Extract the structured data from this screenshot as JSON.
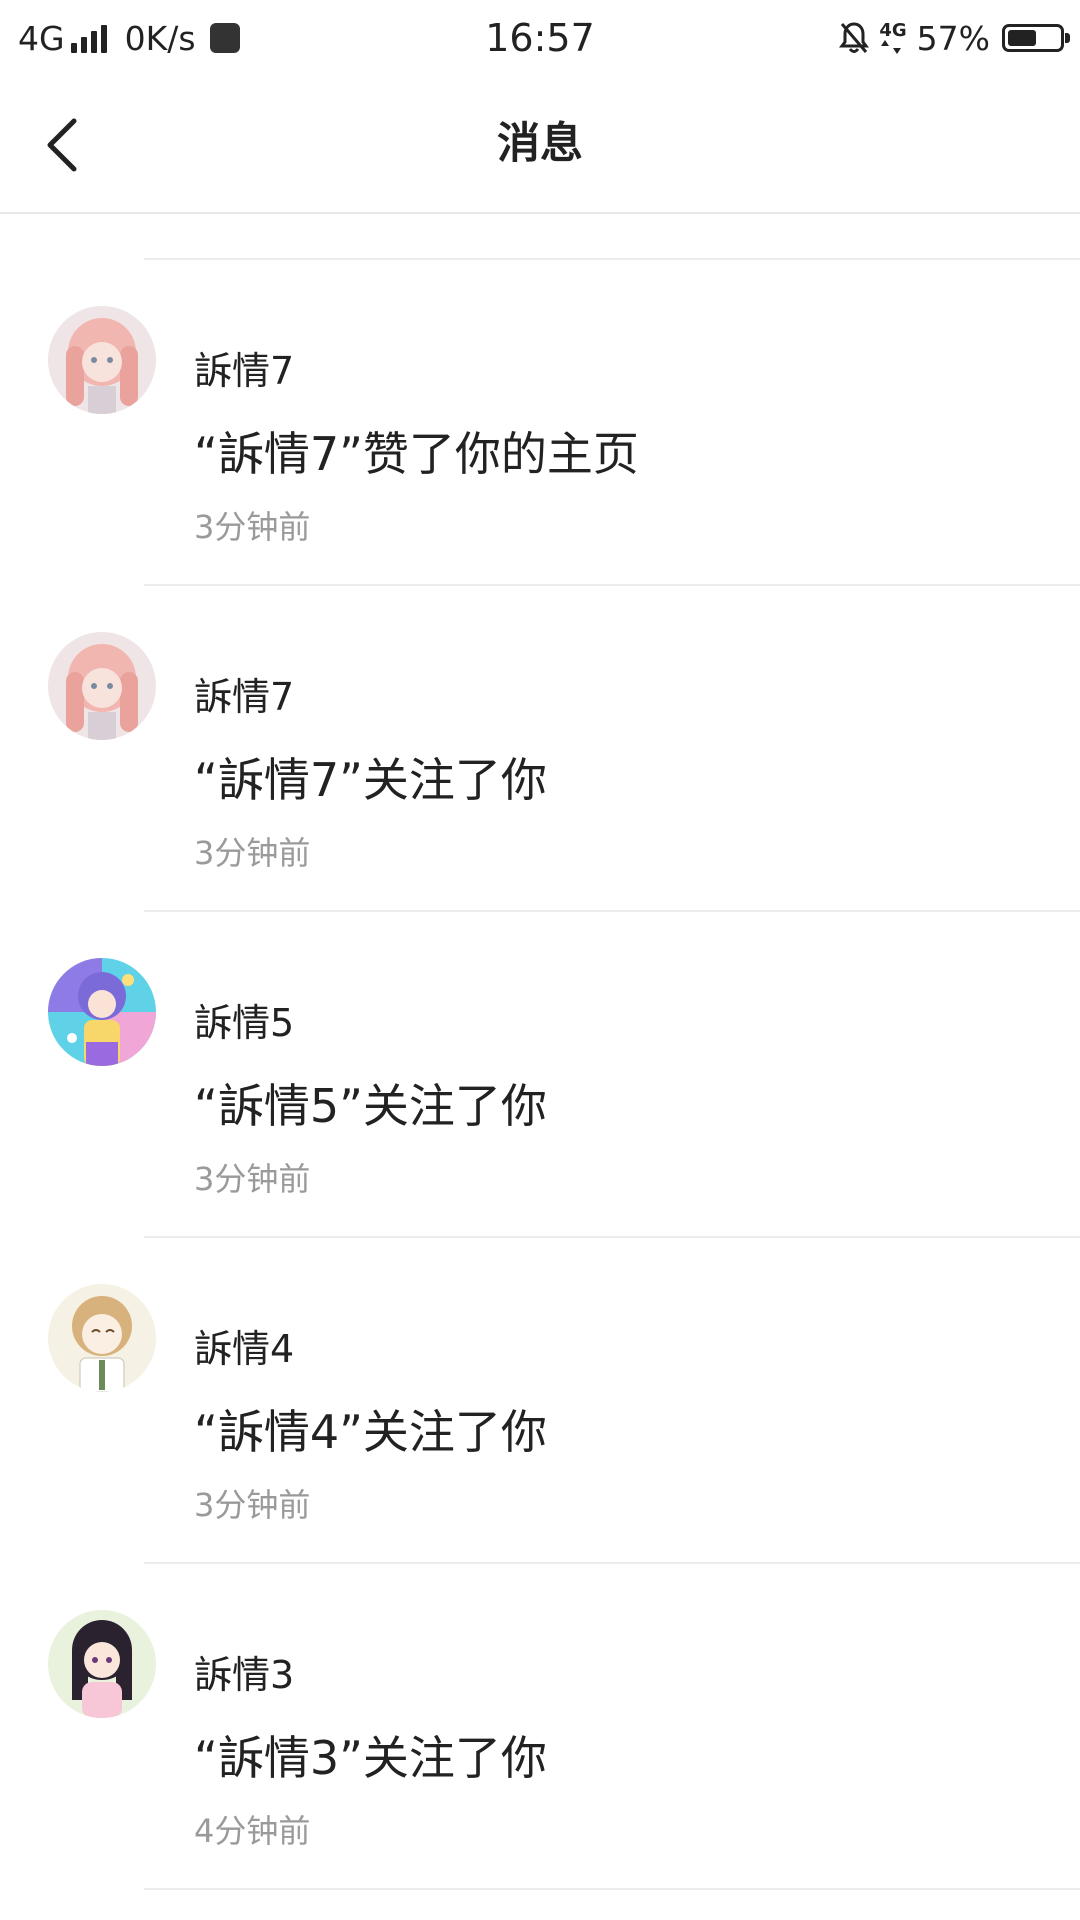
{
  "status_bar": {
    "network": "4G",
    "speed": "0K/s",
    "time": "16:57",
    "network_right": "4G",
    "battery": "57%",
    "battery_level": 0.57
  },
  "header": {
    "title": "消息",
    "back_icon": "chevron-left-icon"
  },
  "messages": [
    {
      "name": "訴情7",
      "content": "“訴情7”赞了你的主页",
      "time": "3分钟前",
      "avatar_colors": [
        "#f2b6b0",
        "#e9a39c",
        "#d8cfd6"
      ]
    },
    {
      "name": "訴情7",
      "content": "“訴情7”关注了你",
      "time": "3分钟前",
      "avatar_colors": [
        "#f2b6b0",
        "#e9a39c",
        "#d8cfd6"
      ]
    },
    {
      "name": "訴情5",
      "content": "“訴情5”关注了你",
      "time": "3分钟前",
      "avatar_colors": [
        "#7b6bd8",
        "#5fd2e8",
        "#f1a6d8"
      ]
    },
    {
      "name": "訴情4",
      "content": "“訴情4”关注了你",
      "time": "3分钟前",
      "avatar_colors": [
        "#f5f1e4",
        "#d8b27c",
        "#6d8a5a"
      ]
    },
    {
      "name": "訴情3",
      "content": "“訴情3”关注了你",
      "time": "4分钟前",
      "avatar_colors": [
        "#e9f2dd",
        "#2b2230",
        "#f7c6d7"
      ]
    }
  ]
}
